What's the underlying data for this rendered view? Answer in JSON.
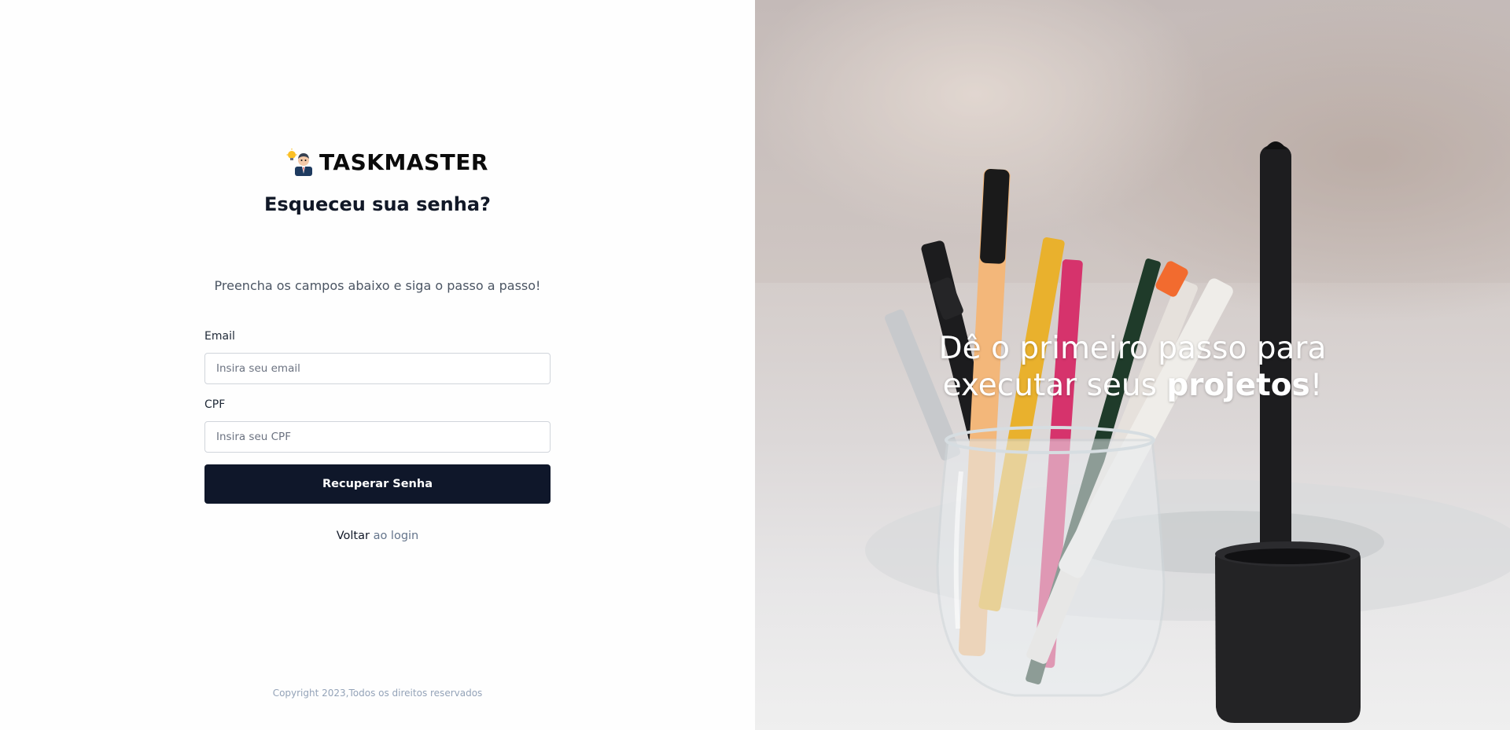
{
  "brand": {
    "name": "TASKMASTER",
    "logo_icon": "businessman-lightbulb-icon"
  },
  "form": {
    "title": "Esqueceu sua senha?",
    "subtitle": "Preencha os campos abaixo e siga o passo a passo!",
    "email": {
      "label": "Email",
      "placeholder": "Insira seu email",
      "value": ""
    },
    "cpf": {
      "label": "CPF",
      "placeholder": "Insira seu CPF",
      "value": ""
    },
    "submit_label": "Recuperar Senha",
    "back_prefix": "Voltar",
    "back_link": "ao login"
  },
  "footer": {
    "copyright": "Copyright 2023,Todos os direitos reservados"
  },
  "hero": {
    "line1": "Dê o primeiro passo para",
    "line2_prefix": "executar seus ",
    "line2_bold": "projetos",
    "line2_suffix": "!"
  },
  "colors": {
    "button_bg": "#0f172a",
    "link": "#64748b",
    "accent_orange": "#f26b2f"
  }
}
